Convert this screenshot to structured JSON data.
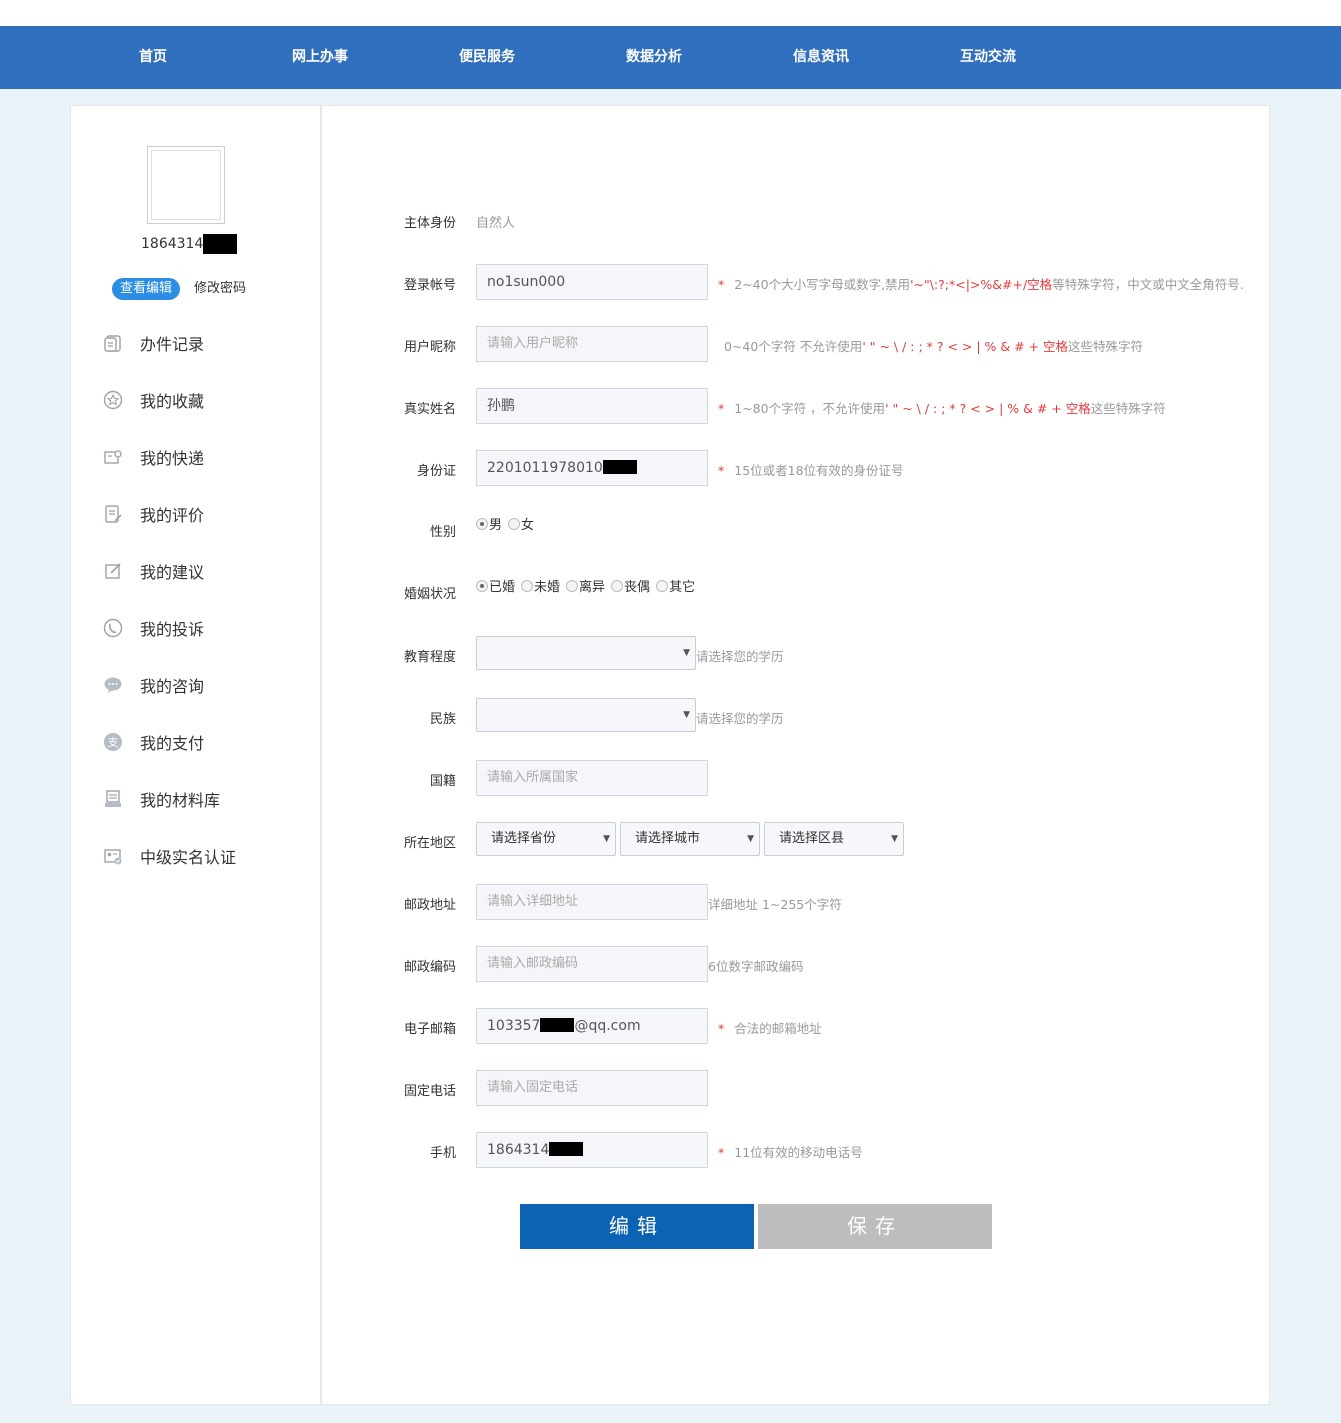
{
  "nav": {
    "items": [
      "首页",
      "网上办事",
      "便民服务",
      "数据分析",
      "信息资讯",
      "互动交流"
    ]
  },
  "sidebar": {
    "username": "1864314",
    "view_edit": "查看编辑",
    "change_password": "修改密码",
    "menu": [
      {
        "label": "办件记录",
        "icon": "record-icon"
      },
      {
        "label": "我的收藏",
        "icon": "star-icon"
      },
      {
        "label": "我的快递",
        "icon": "express-icon"
      },
      {
        "label": "我的评价",
        "icon": "comment-icon"
      },
      {
        "label": "我的建议",
        "icon": "edit-icon"
      },
      {
        "label": "我的投诉",
        "icon": "phone-icon"
      },
      {
        "label": "我的咨询",
        "icon": "chat-icon"
      },
      {
        "label": "我的支付",
        "icon": "payment-icon"
      },
      {
        "label": "我的材料库",
        "icon": "library-icon"
      },
      {
        "label": "中级实名认证",
        "icon": "id-card-icon"
      }
    ]
  },
  "form": {
    "identity": {
      "label": "主体身份",
      "value": "自然人"
    },
    "account": {
      "label": "登录帐号",
      "value": "no1sun000",
      "star": "*",
      "hint_pre": "2~40个大小写字母或数字,禁用",
      "hint_red": "'~\"\\:?;*<|>%&#+/空格",
      "hint_post": "等特殊字符，中文或中文全角符号."
    },
    "nickname": {
      "label": "用户昵称",
      "placeholder": "请输入用户昵称",
      "hint_pre": "0~40个字符 不允许使用",
      "hint_red": "' \" ~ \\ / : ; * ? < > | % & # + 空格",
      "hint_post": "这些特殊字符"
    },
    "realname": {
      "label": "真实姓名",
      "value": "孙鹏",
      "star": "*",
      "hint_pre": "1~80个字符 ，不允许使用",
      "hint_red": "' \" ~ \\ / : ; * ? < > | % & # + 空格",
      "hint_post": "这些特殊字符"
    },
    "idcard": {
      "label": "身份证",
      "value": "2201011978010",
      "star": "*",
      "hint": "15位或者18位有效的身份证号"
    },
    "gender": {
      "label": "性别",
      "options": [
        "男",
        "女"
      ],
      "selected": "男"
    },
    "marital": {
      "label": "婚姻状况",
      "options": [
        "已婚",
        "未婚",
        "离异",
        "丧偶",
        "其它"
      ],
      "selected": "已婚"
    },
    "education": {
      "label": "教育程度",
      "value": "",
      "hint": "请选择您的学历"
    },
    "ethnicity": {
      "label": "民族",
      "value": "",
      "hint": "请选择您的学历"
    },
    "nationality": {
      "label": "国籍",
      "placeholder": "请输入所属国家"
    },
    "region": {
      "label": "所在地区",
      "province": "请选择省份",
      "city": "请选择城市",
      "district": "请选择区县"
    },
    "address": {
      "label": "邮政地址",
      "placeholder": "请输入详细地址",
      "hint": "详细地址 1~255个字符"
    },
    "postcode": {
      "label": "邮政编码",
      "placeholder": "请输入邮政编码",
      "hint": "6位数字邮政编码"
    },
    "email": {
      "label": "电子邮箱",
      "value_pre": "103357",
      "value_post": "@qq.com",
      "star": "*",
      "hint": "合法的邮箱地址"
    },
    "phone": {
      "label": "固定电话",
      "placeholder": "请输入固定电话"
    },
    "mobile": {
      "label": "手机",
      "value": "1864314",
      "star": "*",
      "hint": "11位有效的移动电话号"
    },
    "edit_button": "编辑",
    "save_button": "保存"
  }
}
